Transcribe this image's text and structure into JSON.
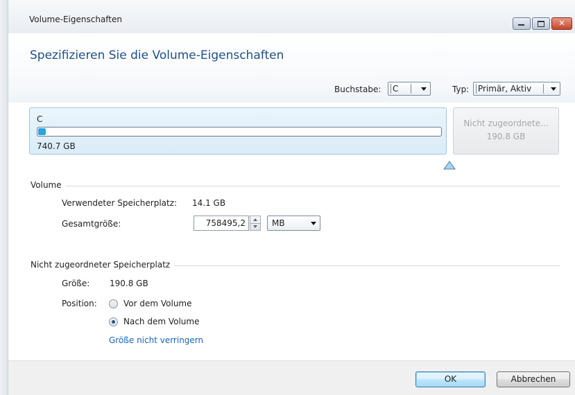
{
  "window": {
    "title": "Volume-Eigenschaften",
    "controls": {
      "minimize": "minimize",
      "maximize": "maximize",
      "close": "✕"
    }
  },
  "header": {
    "heading": "Spezifizieren Sie die Volume-Eigenschaften",
    "letter_label": "Buchstabe:",
    "letter_value": "C",
    "type_label": "Typ:",
    "type_value": "Primär, Aktiv"
  },
  "disk_map": {
    "volume": {
      "letter": "C",
      "size": "740.7 GB",
      "used_fraction": 0.019
    },
    "unallocated": {
      "label": "Nicht zugeordnete...",
      "size": "190.8 GB"
    }
  },
  "volume_section": {
    "title": "Volume",
    "used_label": "Verwendeter Speicherplatz:",
    "used_value": "14.1 GB",
    "total_label": "Gesamtgröße:",
    "total_value": "758495,2",
    "unit_value": "MB"
  },
  "unallocated_section": {
    "title": "Nicht zugeordneter Speicherplatz",
    "size_label": "Größe:",
    "size_value": "190.8 GB",
    "position_label": "Position:",
    "options": [
      {
        "label": "Vor dem Volume",
        "selected": false
      },
      {
        "label": "Nach dem Volume",
        "selected": true
      }
    ],
    "link": "Größe nicht verringern"
  },
  "footer": {
    "ok": "OK",
    "cancel": "Abbrechen"
  },
  "colors": {
    "heading": "#1f4f8a",
    "link": "#1565c0",
    "bar_fill": "#2aa4de"
  }
}
